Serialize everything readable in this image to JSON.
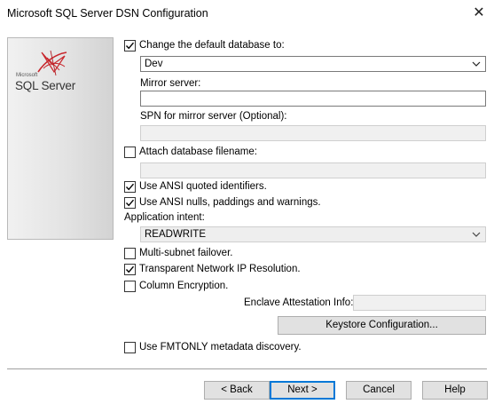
{
  "window": {
    "title": "Microsoft SQL Server DSN Configuration",
    "close_glyph": "✕"
  },
  "logo": {
    "microsoft": "Microsoft",
    "product": "SQL Server"
  },
  "options": {
    "change_db": {
      "label": "Change the default database to:",
      "checked": true
    },
    "database": {
      "value": "Dev"
    },
    "mirror_server": {
      "label": "Mirror server:",
      "value": ""
    },
    "spn": {
      "label": "SPN for mirror server (Optional):",
      "value": ""
    },
    "attach_db": {
      "label": "Attach database filename:",
      "checked": false,
      "value": ""
    },
    "ansi_quoted": {
      "label": "Use ANSI quoted identifiers.",
      "checked": true
    },
    "ansi_nulls": {
      "label": "Use ANSI nulls, paddings and warnings.",
      "checked": true
    },
    "app_intent": {
      "label": "Application intent:",
      "value": "READWRITE"
    },
    "multi_subnet": {
      "label": "Multi-subnet failover.",
      "checked": false
    },
    "tnir": {
      "label": "Transparent Network IP Resolution.",
      "checked": true
    },
    "column_encryption": {
      "label": "Column Encryption.",
      "checked": false
    },
    "enclave": {
      "label": "Enclave Attestation Info:",
      "value": ""
    },
    "keystore_button": "Keystore Configuration...",
    "fmtonly": {
      "label": "Use FMTONLY metadata discovery.",
      "checked": false
    }
  },
  "buttons": {
    "back": "< Back",
    "next": "Next >",
    "cancel": "Cancel",
    "help": "Help"
  },
  "colors": {
    "accent": "#0078d7",
    "logo_red": "#c8262c"
  },
  "icons": {
    "check": "check-icon",
    "dropdown": "chevron-down-icon",
    "close": "close-icon",
    "logo": "sql-server-logo-icon"
  }
}
